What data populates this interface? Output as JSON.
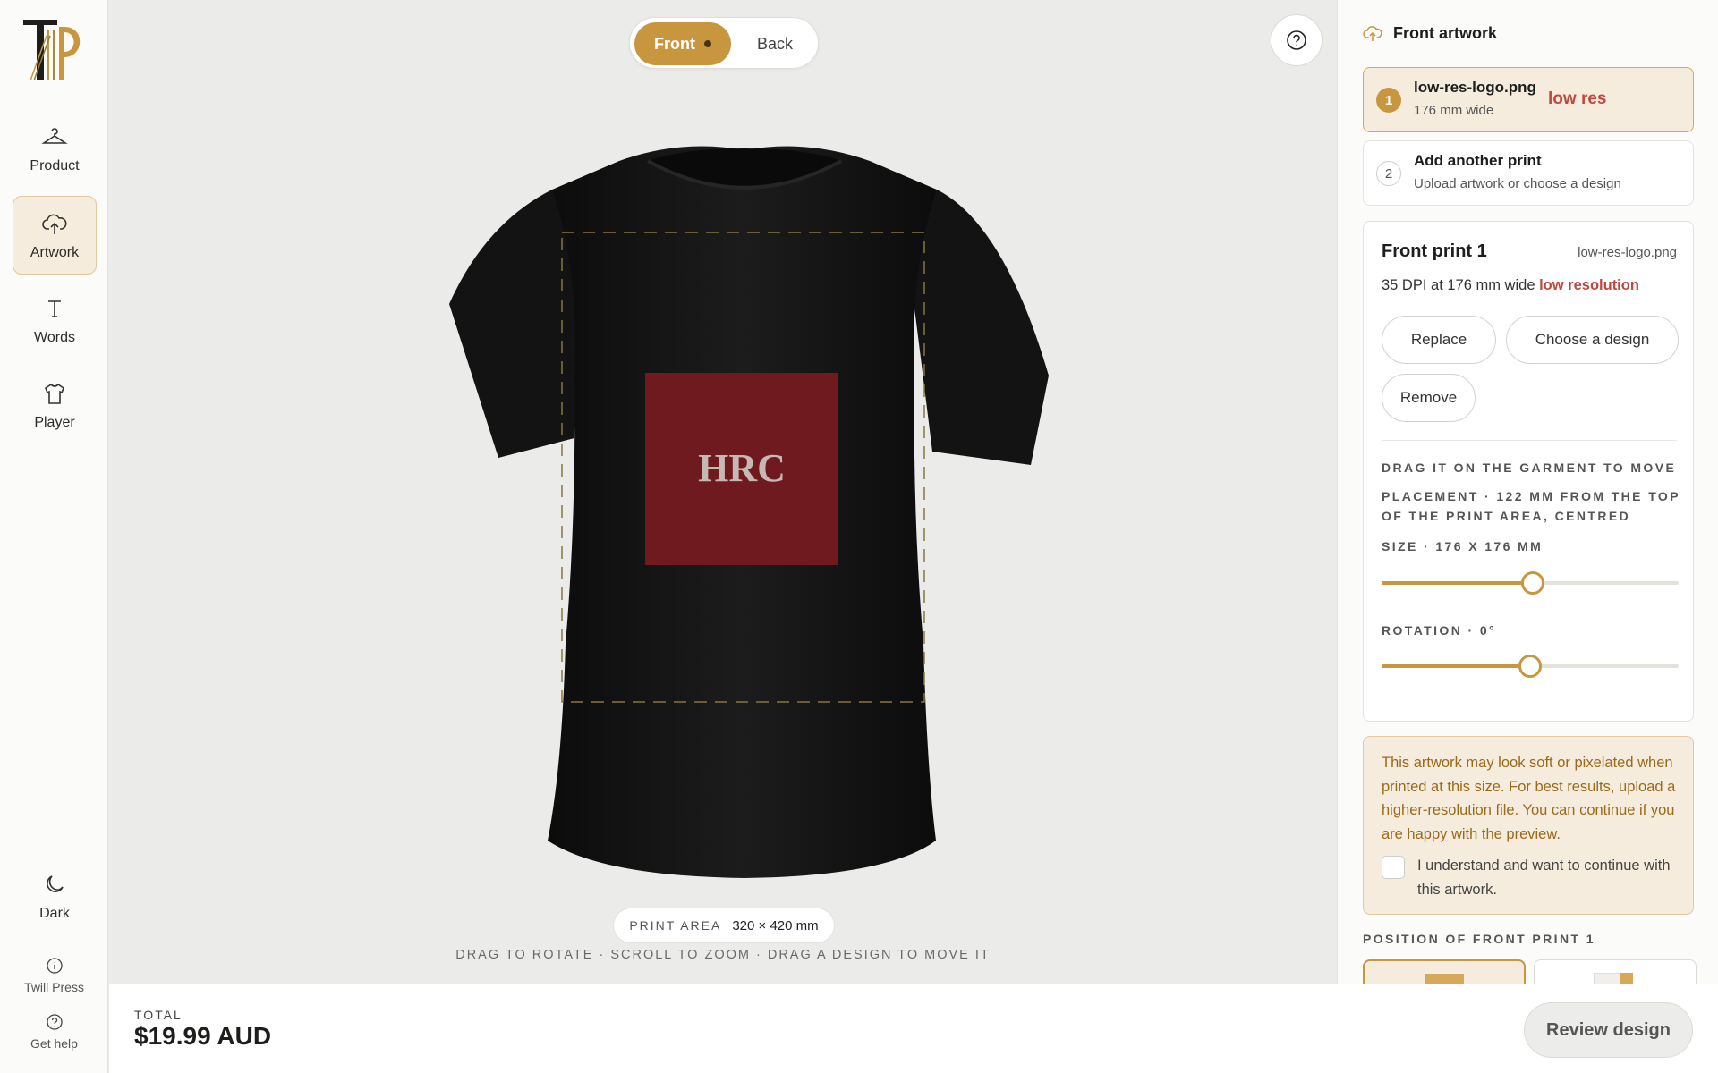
{
  "brand": {
    "logo_letters": "TP",
    "accent": "#c8963f"
  },
  "rail": {
    "items": [
      {
        "label": "Product",
        "icon": "hanger-icon"
      },
      {
        "label": "Artwork",
        "icon": "cloud-upload-icon",
        "active": true
      },
      {
        "label": "Words",
        "icon": "text-icon"
      },
      {
        "label": "Player",
        "icon": "tshirt-icon"
      }
    ],
    "dark": "Dark",
    "twill": "Twill Press",
    "help": "Get help"
  },
  "canvas": {
    "front": "Front",
    "back": "Back",
    "artwork_text": "HRC",
    "print_area_label": "PRINT AREA",
    "print_area_value": "320 × 420 mm",
    "hint": "DRAG TO ROTATE · SCROLL TO ZOOM · DRAG A DESIGN TO MOVE IT"
  },
  "panel": {
    "title": "Front artwork",
    "slot1": {
      "num": "1",
      "name": "low-res-logo.png",
      "width": "176 mm wide",
      "warn": "low res"
    },
    "slot2": {
      "num": "2",
      "name": "Add another print",
      "sub": "Upload artwork or choose a design"
    },
    "card": {
      "title": "Front print 1",
      "file": "low-res-logo.png",
      "dpi": "35 DPI at 176 mm wide",
      "dpi_warn": "low resolution",
      "replace": "Replace",
      "choose": "Choose a design",
      "remove": "Remove",
      "drag_hint": "DRAG IT ON THE GARMENT TO MOVE",
      "placement": "PLACEMENT · 122 MM FROM THE TOP OF THE PRINT AREA, CENTRED",
      "size_label": "SIZE · 176 X 176 MM",
      "size_fraction": 0.51,
      "rotation_label": "ROTATION · 0°",
      "rotation_fraction": 0.5
    },
    "notice": {
      "text": "This artwork may look soft or pixelated when printed at this size. For best results, upload a higher-resolution file. You can continue if you are happy with the preview.",
      "checkbox": "I understand and want to continue with this artwork."
    },
    "position_label": "POSITION OF FRONT PRINT 1"
  },
  "bottom": {
    "total_label": "TOTAL",
    "total_value": "$19.99 AUD",
    "review": "Review design"
  }
}
